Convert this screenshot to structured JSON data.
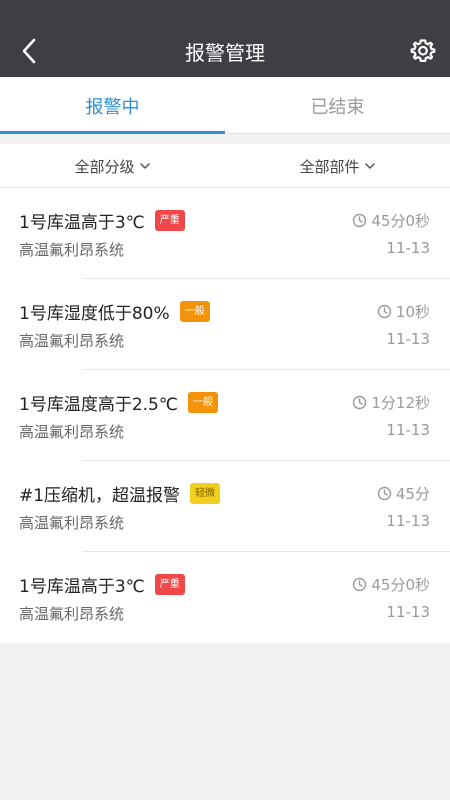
{
  "header": {
    "title": "报警管理",
    "back_icon": "chevron-left-icon",
    "settings_icon": "gear-icon"
  },
  "tabs": [
    {
      "label": "报警中",
      "active": true
    },
    {
      "label": "已结束",
      "active": false
    }
  ],
  "filters": {
    "level": "全部分级",
    "part": "全部部件"
  },
  "colors": {
    "accent": "#2b8fd6",
    "header_bg": "#3d3f44",
    "severe": "#f04848",
    "normal": "#f2930a",
    "minor": "#f1cf1c"
  },
  "alarms": [
    {
      "title": "1号库温高于3℃",
      "level": "严重",
      "system": "高温氟利昂系统",
      "duration": "45分0秒",
      "date": "11-13"
    },
    {
      "title": "1号库湿度低于80%",
      "level": "一般",
      "system": "高温氟利昂系统",
      "duration": "10秒",
      "date": "11-13"
    },
    {
      "title": "1号库温度高于2.5℃",
      "level": "一般",
      "system": "高温氟利昂系统",
      "duration": "1分12秒",
      "date": "11-13"
    },
    {
      "title": "#1压缩机，超温报警",
      "level": "轻微",
      "system": "高温氟利昂系统",
      "duration": "45分",
      "date": "11-13"
    },
    {
      "title": "1号库温高于3℃",
      "level": "严重",
      "system": "高温氟利昂系统",
      "duration": "45分0秒",
      "date": "11-13"
    }
  ]
}
